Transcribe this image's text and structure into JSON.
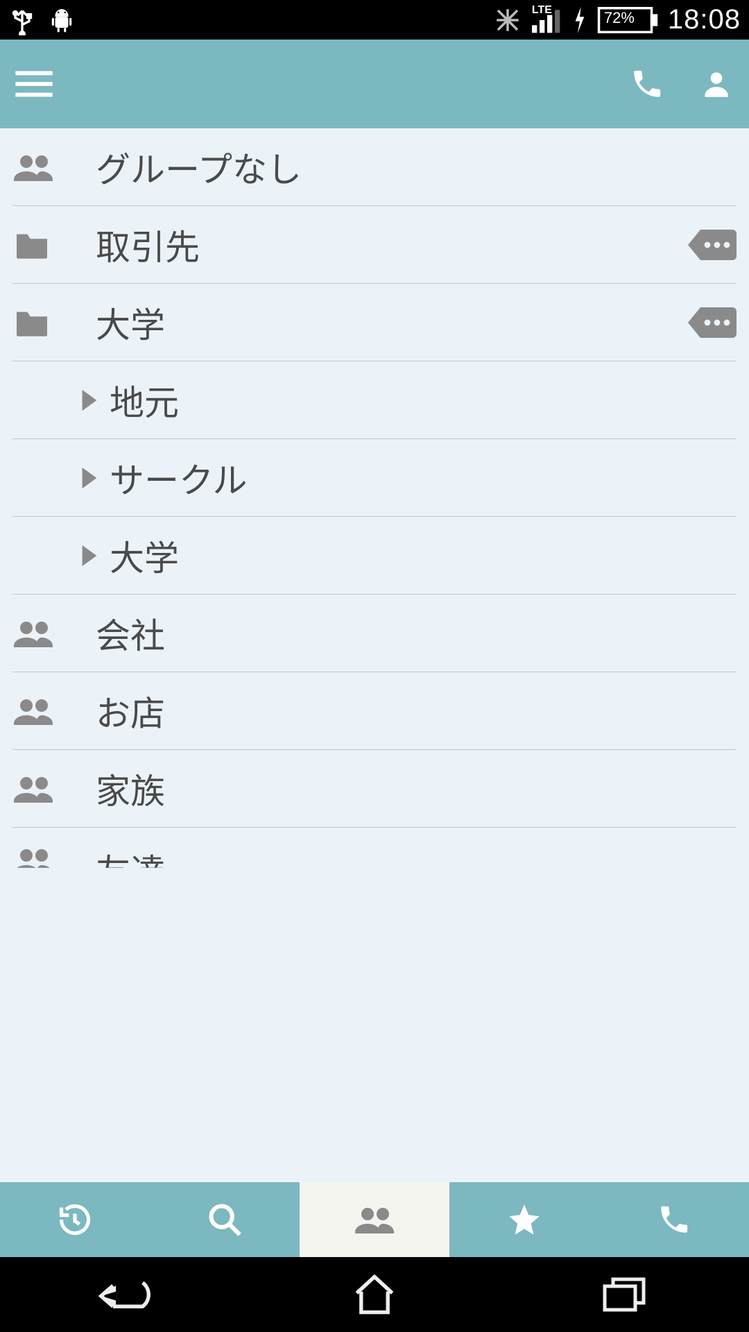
{
  "status_bar": {
    "network_label": "LTE",
    "battery_pct": "72%",
    "clock": "18:08"
  },
  "groups": [
    {
      "kind": "group",
      "label": "グループなし",
      "more": false
    },
    {
      "kind": "folder",
      "label": "取引先",
      "more": true
    },
    {
      "kind": "folder",
      "label": "大学",
      "more": true
    },
    {
      "kind": "sub",
      "label": "地元"
    },
    {
      "kind": "sub",
      "label": "サークル"
    },
    {
      "kind": "sub",
      "label": "大学"
    },
    {
      "kind": "group",
      "label": "会社",
      "more": false
    },
    {
      "kind": "group",
      "label": "お店",
      "more": false
    },
    {
      "kind": "group",
      "label": "家族",
      "more": false
    },
    {
      "kind": "group",
      "label": "友達",
      "more": false,
      "partial": true
    }
  ],
  "bottom_tabs": {
    "active_index": 2
  }
}
